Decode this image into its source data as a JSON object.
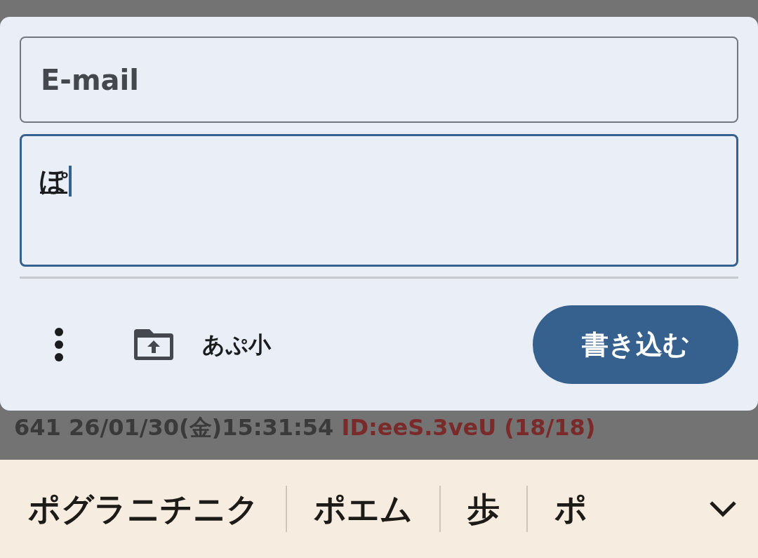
{
  "form": {
    "email": {
      "placeholder": "E-mail"
    },
    "message": {
      "value": "ぽ"
    },
    "upload_label": "あぷ小",
    "submit": "書き込む"
  },
  "post": {
    "number": "641",
    "datetime": "26/01/30(金)15:31:54",
    "id": "ID:eeS.3veU (18/18)"
  },
  "bottom_bar": {
    "items": [
      "ポグラニチニク",
      "ポエム",
      "歩",
      "ポ"
    ]
  }
}
